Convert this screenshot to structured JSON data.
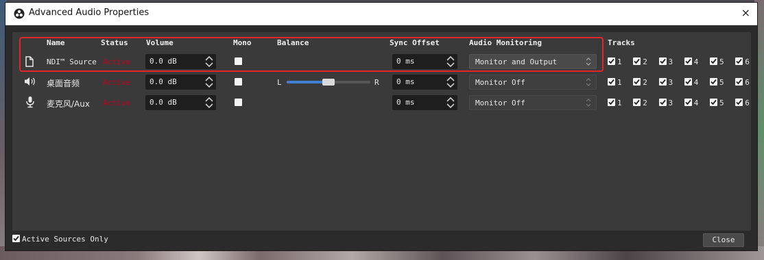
{
  "window": {
    "title": "Advanced Audio Properties",
    "close_glyph": "×"
  },
  "headers": {
    "name": "Name",
    "status": "Status",
    "volume": "Volume",
    "mono": "Mono",
    "balance": "Balance",
    "sync_offset": "Sync Offset",
    "audio_monitoring": "Audio Monitoring",
    "tracks": "Tracks"
  },
  "rows": [
    {
      "icon": "file-icon",
      "name": "NDI™ Source",
      "status": "Active",
      "volume": "0.0 dB",
      "mono": true,
      "balance_shown": false,
      "sync_offset": "0 ms",
      "monitoring": "Monitor and Output",
      "tracks": [
        "1",
        "2",
        "3",
        "4",
        "5",
        "6"
      ]
    },
    {
      "icon": "speaker-icon",
      "name": "桌面音频",
      "status": "Active",
      "volume": "0.0 dB",
      "mono": true,
      "balance_shown": true,
      "balance_left": "L",
      "balance_right": "R",
      "balance_value": 0.5,
      "sync_offset": "0 ms",
      "monitoring": "Monitor Off",
      "tracks": [
        "1",
        "2",
        "3",
        "4",
        "5",
        "6"
      ]
    },
    {
      "icon": "microphone-icon",
      "name": "麦克风/Aux",
      "status": "Active",
      "volume": "0.0 dB",
      "mono": true,
      "balance_shown": false,
      "sync_offset": "0 ms",
      "monitoring": "Monitor Off",
      "tracks": [
        "1",
        "2",
        "3",
        "4",
        "5",
        "6"
      ]
    }
  ],
  "footer": {
    "active_sources_label": "Active Sources Only",
    "active_sources_checked": true,
    "close_label": "Close"
  },
  "colors": {
    "status_active": "#c4001e",
    "highlight": "#e3262a",
    "slider_fill": "#3f7fd1"
  }
}
